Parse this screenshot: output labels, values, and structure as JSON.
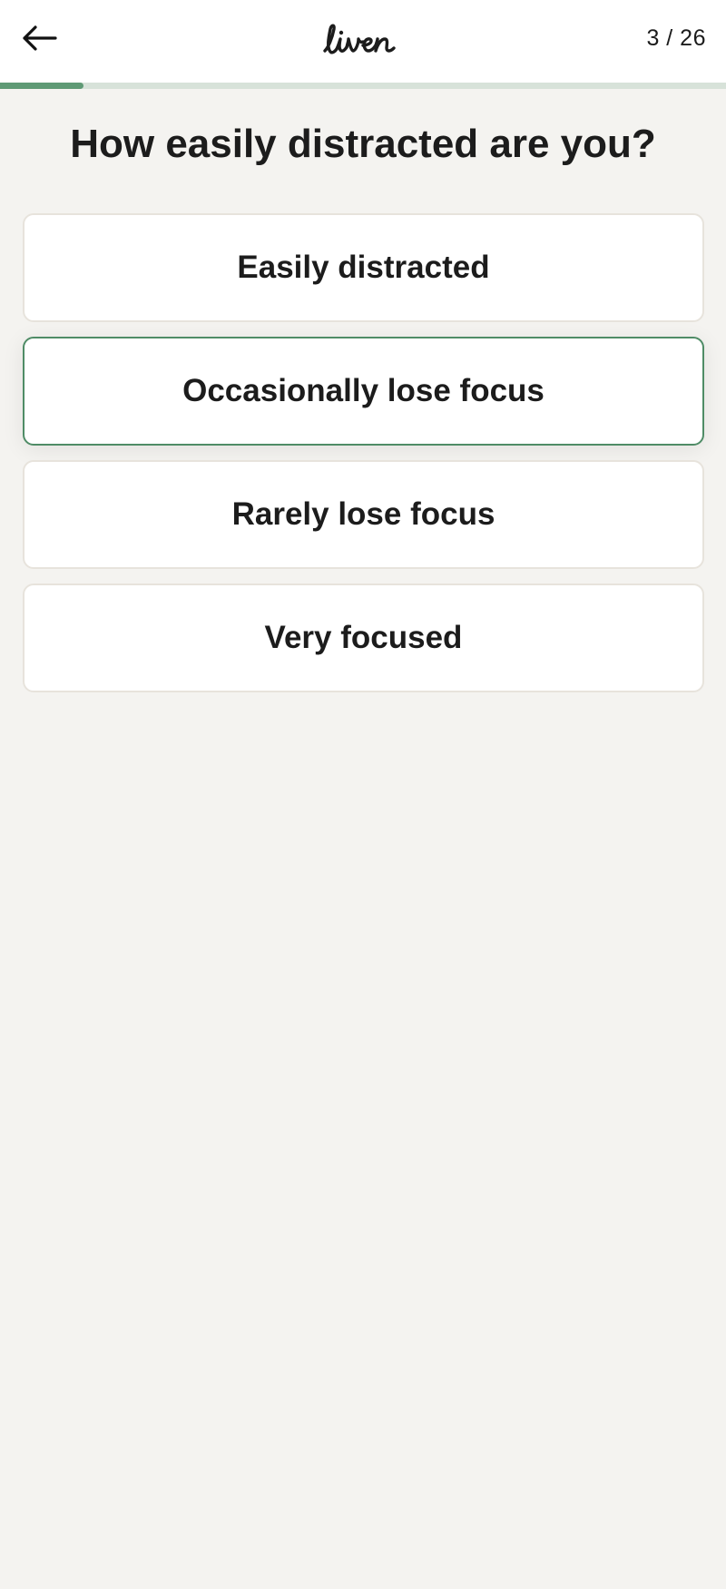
{
  "header": {
    "back_icon": "arrow-left-icon",
    "logo_text": "liven",
    "step_counter": "3 / 26"
  },
  "progress": {
    "current": 3,
    "total": 26,
    "fraction": 0.115,
    "fill_color": "#5f9a75",
    "track_color": "#d7e2d9"
  },
  "question": {
    "title": "How easily distracted are you?"
  },
  "options": [
    {
      "label": "Easily distracted",
      "selected": false
    },
    {
      "label": "Occasionally lose focus",
      "selected": true
    },
    {
      "label": "Rarely lose focus",
      "selected": false
    },
    {
      "label": "Very focused",
      "selected": false
    }
  ],
  "colors": {
    "background": "#f4f3f0",
    "selected_border": "#4f8c66",
    "text": "#1c1c1c"
  }
}
